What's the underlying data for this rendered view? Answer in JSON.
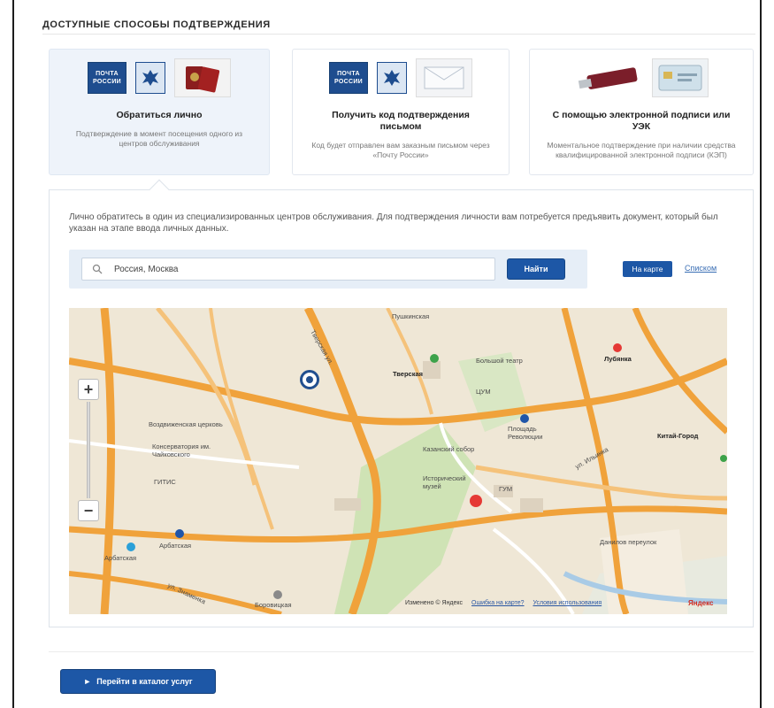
{
  "section": {
    "title": "ДОСТУПНЫЕ СПОСОБЫ ПОДТВЕРЖДЕНИЯ"
  },
  "methods": [
    {
      "title": "Обратиться лично",
      "description": "Подтверждение в момент посещения одного из центров обслуживания",
      "logo_text": "ПОЧТА РОССИИ",
      "icons": [
        "pochta-logo",
        "eagle-emblem",
        "passport-image"
      ]
    },
    {
      "title": "Получить код подтверждения письмом",
      "description": "Код будет отправлен вам заказным письмом через «Почту России»",
      "logo_text": "ПОЧТА РОССИИ",
      "icons": [
        "pochta-logo",
        "eagle-emblem",
        "envelope-image"
      ]
    },
    {
      "title": "С помощью электронной подписи или УЭК",
      "description": "Моментальное подтверждение при наличии средства квалифицированной электронной подписи (КЭП)",
      "icons": [
        "usb-token-image",
        "uek-card-image"
      ]
    }
  ],
  "details": {
    "intro": "Лично обратитесь в один из специализированных центров обслуживания. Для подтверждения личности вам потребуется предъявить документ, который был указан на этапе ввода личных данных.",
    "search": {
      "value": "Россия, Москва",
      "button_label": "Найти"
    },
    "view": {
      "map_label": "На карте",
      "list_label": "Списком"
    }
  },
  "map": {
    "labels": {
      "tverskaya": "Тверская",
      "pushkinskaya": "Пушкинская",
      "lubyanka": "Лубянка",
      "ploshchad_revolyutsii": "Площадь Революции",
      "kitay_gorod": "Китай-Город",
      "arbatskaya": "Арбатская",
      "borovitskaya": "Боровицкая",
      "tverskaya_ul": "Тверская ул.",
      "ul_znamenka": "ул. Знаменка",
      "vozdvizhenka": "Воздвиженская церковь",
      "konservatoriya": "Консерватория им. Чайковского",
      "gitis": "ГИТИС",
      "gum": "ГУМ",
      "istorichesky_muzey": "Исторический музей",
      "bolshoy": "Большой театр",
      "kazansky_sobor": "Казанский собор",
      "ul_ilyinka": "ул. Ильинка",
      "tsum": "ЦУМ",
      "danilovsky": "Данилов переулок"
    },
    "zoom_in": "+",
    "zoom_out": "−",
    "footer_copy": "Изменено © Яндекс",
    "footer_error": "Ошибка на карте?",
    "footer_terms": "Условия использования",
    "brand": "Яндекс"
  },
  "footer": {
    "catalog_button": "Перейти в каталог услуг"
  },
  "colors": {
    "accent": "#1d57a6",
    "panel_bg": "#eef3fa",
    "map_bg": "#efe7d6",
    "road": "#f0a23b",
    "metro": "#e53935"
  }
}
